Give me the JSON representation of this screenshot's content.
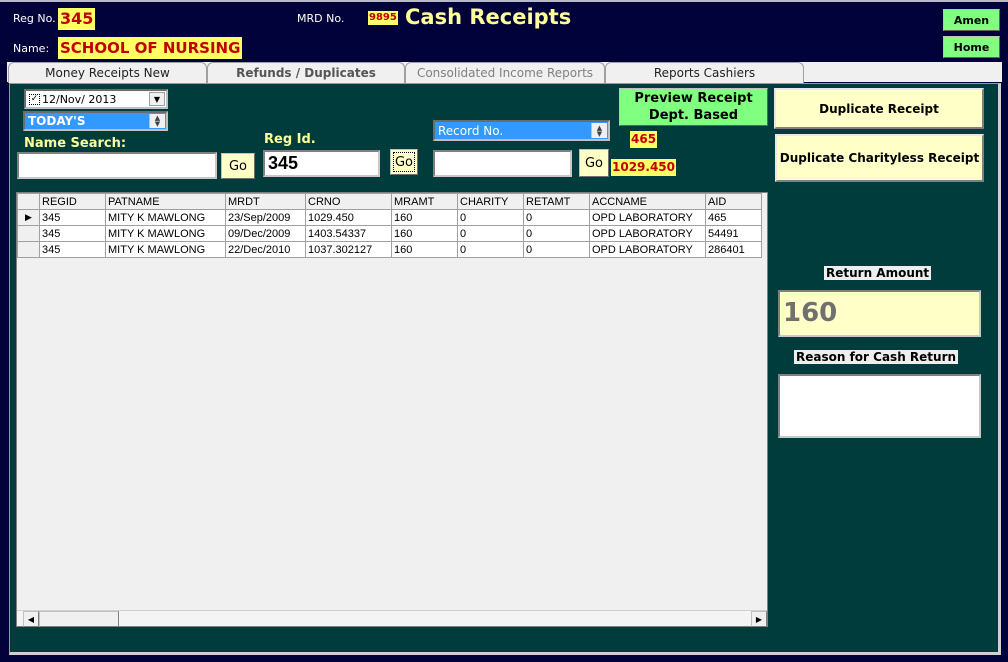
{
  "header": {
    "reg_no_label": "Reg No.",
    "reg_no_value": "345",
    "name_label": "Name:",
    "name_value": "SCHOOL OF NURSING",
    "mrd_no_label": "MRD No.",
    "mrd_no_value": "9895",
    "title": "Cash Receipts",
    "amen_button": "Amen",
    "home_button": "Home"
  },
  "tabs": [
    {
      "label": "Money Receipts New",
      "state": "normal"
    },
    {
      "label": "Refunds / Duplicates",
      "state": "active"
    },
    {
      "label": "Consolidated Income Reports",
      "state": "disabled"
    },
    {
      "label": "Reports Cashiers",
      "state": "normal"
    }
  ],
  "filters": {
    "date_checked": true,
    "date_value": "12/Nov/ 2013",
    "period_value": "TODAY'S",
    "name_search_label": "Name Search:",
    "name_search_value": "",
    "name_go": "Go",
    "reg_id_label": "Reg Id.",
    "reg_id_value": "345",
    "reg_go": "Go",
    "record_selector_value": "Record No.",
    "record_value": "",
    "record_go": "Go"
  },
  "preview_button": {
    "line1": "Preview Receipt",
    "line2": "Dept. Based"
  },
  "info": {
    "aid": "465",
    "crno": "1029.450"
  },
  "actions": {
    "duplicate_receipt": "Duplicate Receipt",
    "duplicate_charityless": "Duplicate Charityless Receipt"
  },
  "grid": {
    "columns": [
      "REGID",
      "PATNAME",
      "MRDT",
      "CRNO",
      "MRAMT",
      "CHARITY",
      "RETAMT",
      "ACCNAME",
      "AID"
    ],
    "rows": [
      [
        "345",
        "MITY K MAWLONG",
        "23/Sep/2009",
        "1029.450",
        "160",
        "0",
        "0",
        "OPD LABORATORY",
        "465"
      ],
      [
        "345",
        "MITY K MAWLONG",
        "09/Dec/2009",
        "1403.54337",
        "160",
        "0",
        "0",
        "OPD LABORATORY",
        "54491"
      ],
      [
        "345",
        "MITY K MAWLONG",
        "22/Dec/2010",
        "1037.302127",
        "160",
        "0",
        "0",
        "OPD LABORATORY",
        "286401"
      ]
    ],
    "selected_row": 0
  },
  "return": {
    "amount_label": "Return Amount",
    "amount_value": "160",
    "reason_label": "Reason for Cash Return",
    "reason_value": ""
  }
}
